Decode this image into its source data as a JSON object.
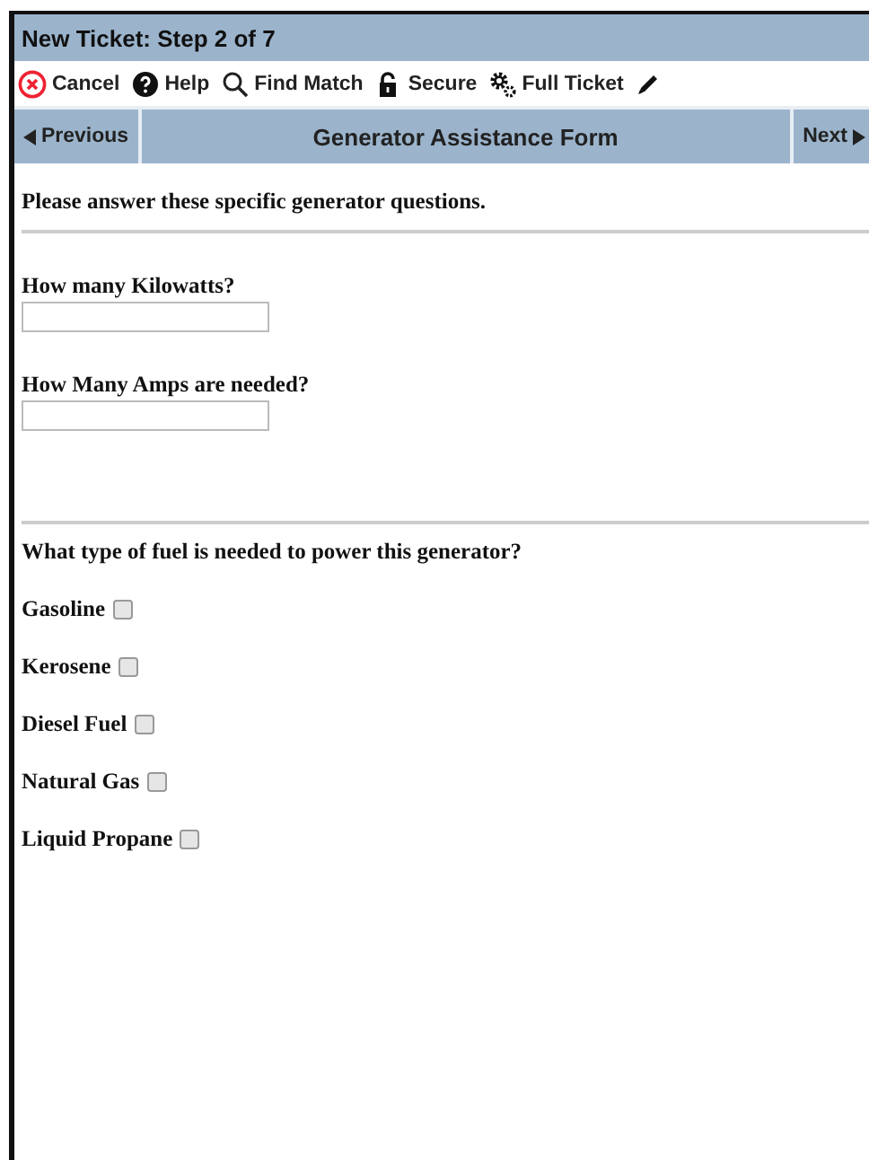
{
  "window": {
    "title": "New Ticket: Step 2 of 7"
  },
  "toolbar": [
    {
      "kind": "cancel",
      "label": "Cancel"
    },
    {
      "kind": "help",
      "label": "Help"
    },
    {
      "kind": "search",
      "label": "Find Match"
    },
    {
      "kind": "lock",
      "label": "Secure"
    },
    {
      "kind": "gears",
      "label": "Full Ticket"
    },
    {
      "kind": "pencil"
    }
  ],
  "nav": {
    "previous": "Previous",
    "title": "Generator Assistance Form",
    "next": "Next"
  },
  "intro": "Please answer these specific generator questions.",
  "fields": [
    {
      "label": "How many Kilowatts?"
    },
    {
      "label": "How Many Amps are needed?"
    }
  ],
  "fuel_question": "What type of fuel is needed to power this generator?",
  "fuel_options": [
    {
      "label": "Gasoline",
      "checked": false
    },
    {
      "label": "Kerosene",
      "checked": false
    },
    {
      "label": "Diesel Fuel",
      "checked": false
    },
    {
      "label": "Natural Gas",
      "checked": false
    },
    {
      "label": "Liquid Propane",
      "checked": false
    }
  ]
}
